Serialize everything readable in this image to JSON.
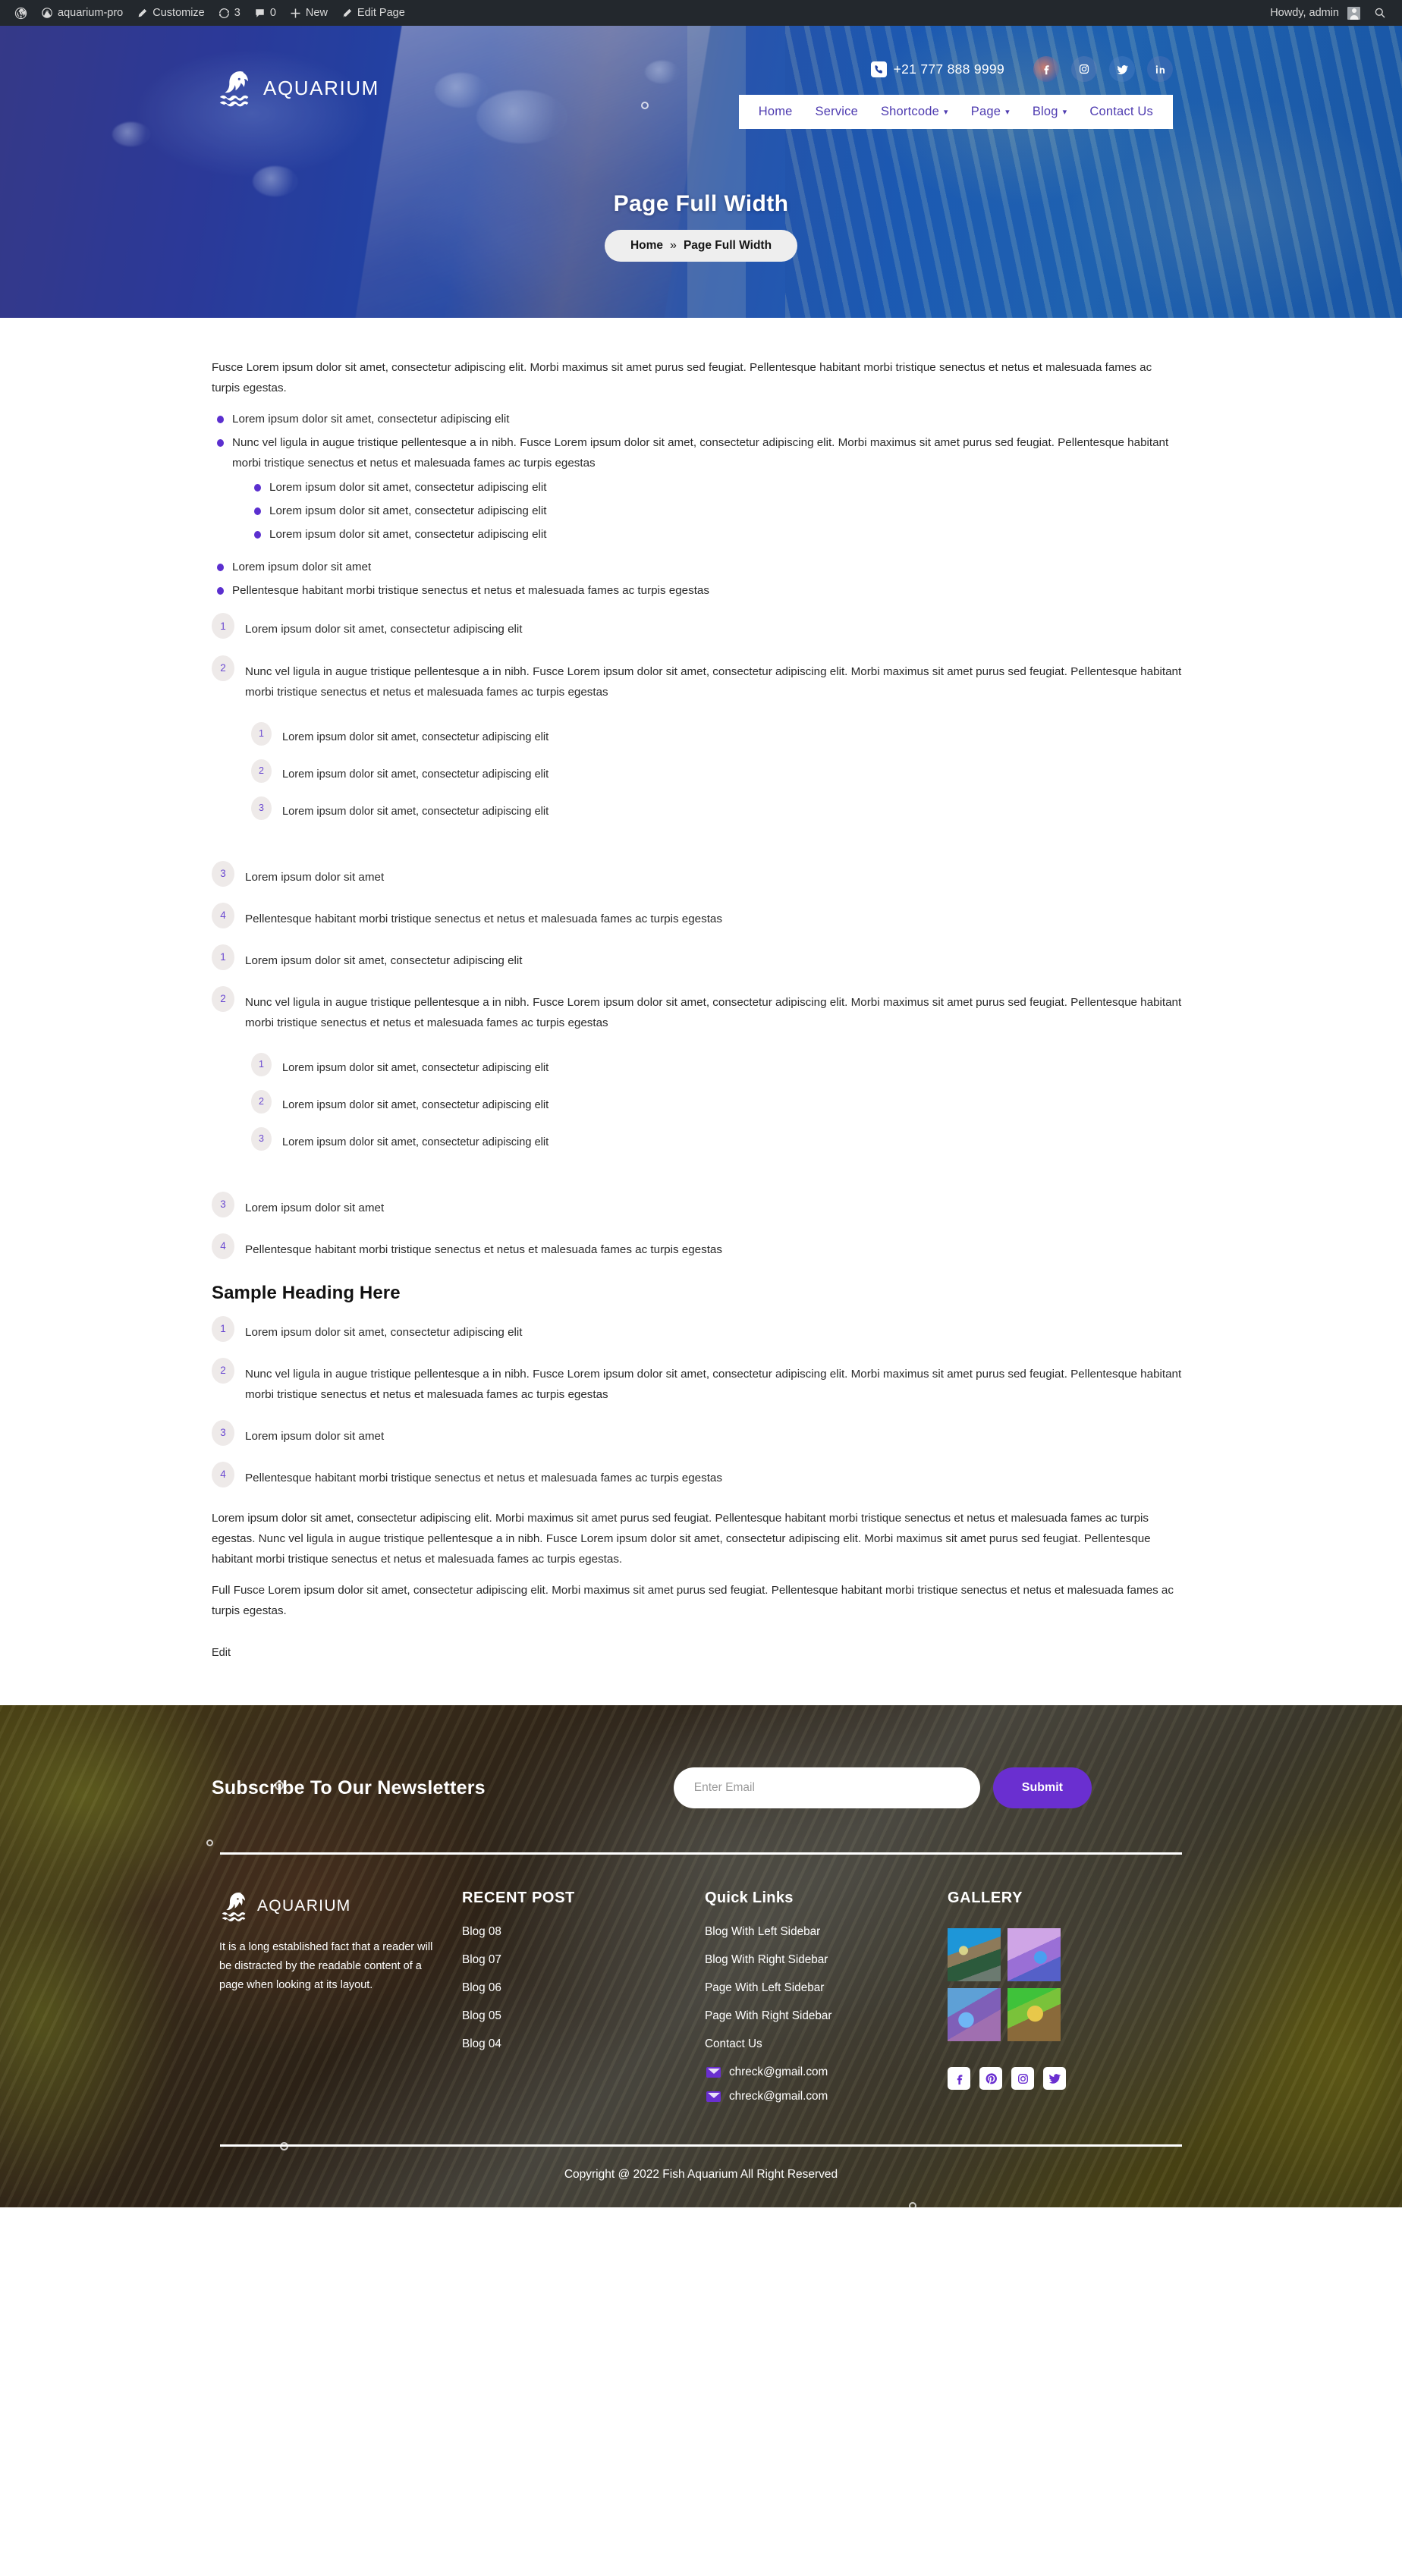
{
  "adminbar": {
    "wp_logo_icon": "wordpress-icon",
    "site_icon": "dashboard-icon",
    "site_name": "aquarium-pro",
    "customize_icon": "pencil-icon",
    "customize_label": "Customize",
    "updates_icon": "updates-icon",
    "updates_count": "3",
    "comments_icon": "comment-icon",
    "comments_count": "0",
    "new_icon": "plus-icon",
    "new_label": "New",
    "edit_icon": "edit-pencil-icon",
    "edit_label": "Edit Page",
    "howdy": "Howdy, admin",
    "avatar_icon": "user-avatar-icon",
    "search_icon": "search-icon"
  },
  "header": {
    "logo_icon": "dolphin-logo-icon",
    "logo_text": "AQUARIUM",
    "phone_icon": "phone-icon",
    "phone": "+21 777 888 9999",
    "socials": [
      {
        "name": "facebook-icon",
        "glyph": "f"
      },
      {
        "name": "instagram-icon",
        "glyph": "ig"
      },
      {
        "name": "twitter-icon",
        "glyph": "tw"
      },
      {
        "name": "linkedin-icon",
        "glyph": "in"
      }
    ],
    "nav": [
      {
        "label": "Home",
        "has_caret": false
      },
      {
        "label": "Service",
        "has_caret": false
      },
      {
        "label": "Shortcode",
        "has_caret": true
      },
      {
        "label": "Page",
        "has_caret": true
      },
      {
        "label": "Blog",
        "has_caret": true
      },
      {
        "label": "Contact Us",
        "has_caret": false
      }
    ]
  },
  "hero": {
    "title": "Page Full Width",
    "breadcrumb_home": "Home",
    "breadcrumb_sep": "»",
    "breadcrumb_current": "Page Full Width"
  },
  "main": {
    "intro_paragraph": "Fusce Lorem ipsum dolor sit amet, consectetur adipiscing elit. Morbi maximus sit amet purus sed feugiat. Pellentesque habitant morbi tristique senectus et netus et malesuada fames ac turpis egestas.",
    "bullets": {
      "item1": "Lorem ipsum dolor sit amet, consectetur adipiscing elit",
      "item2": "Nunc vel ligula in augue tristique pellentesque a in nibh. Fusce Lorem ipsum dolor sit amet, consectetur adipiscing elit. Morbi maximus sit amet purus sed feugiat. Pellentesque habitant morbi tristique senectus et netus et malesuada fames ac turpis egestas",
      "sub1": "Lorem ipsum dolor sit amet, consectetur adipiscing elit",
      "sub2": "Lorem ipsum dolor sit amet, consectetur adipiscing elit",
      "sub3": "Lorem ipsum dolor sit amet, consectetur adipiscing elit",
      "item3": "Lorem ipsum dolor sit amet",
      "item4": "Pellentesque habitant morbi tristique senectus et netus et malesuada fames ac turpis egestas"
    },
    "numlist_a": {
      "n1": "1",
      "t1": "Lorem ipsum dolor sit amet, consectetur adipiscing elit",
      "n2": "2",
      "t2": "Nunc vel ligula in augue tristique pellentesque a in nibh. Fusce Lorem ipsum dolor sit amet, consectetur adipiscing elit. Morbi maximus sit amet purus sed feugiat. Pellentesque habitant morbi tristique senectus et netus et malesuada fames ac turpis egestas",
      "s1n": "1",
      "s1t": "Lorem ipsum dolor sit amet, consectetur adipiscing elit",
      "s2n": "2",
      "s2t": "Lorem ipsum dolor sit amet, consectetur adipiscing elit",
      "s3n": "3",
      "s3t": "Lorem ipsum dolor sit amet, consectetur adipiscing elit",
      "n3": "3",
      "t3": "Lorem ipsum dolor sit amet",
      "n4": "4",
      "t4": "Pellentesque habitant morbi tristique senectus et netus et malesuada fames ac turpis egestas"
    },
    "numlist_b": {
      "n1": "1",
      "t1": "Lorem ipsum dolor sit amet, consectetur adipiscing elit",
      "n2": "2",
      "t2": "Nunc vel ligula in augue tristique pellentesque a in nibh. Fusce Lorem ipsum dolor sit amet, consectetur adipiscing elit. Morbi maximus sit amet purus sed feugiat. Pellentesque habitant morbi tristique senectus et netus et malesuada fames ac turpis egestas",
      "s1n": "1",
      "s1t": "Lorem ipsum dolor sit amet, consectetur adipiscing elit",
      "s2n": "2",
      "s2t": "Lorem ipsum dolor sit amet, consectetur adipiscing elit",
      "s3n": "3",
      "s3t": "Lorem ipsum dolor sit amet, consectetur adipiscing elit",
      "n3": "3",
      "t3": "Lorem ipsum dolor sit amet",
      "n4": "4",
      "t4": "Pellentesque habitant morbi tristique senectus et netus et malesuada fames ac turpis egestas"
    },
    "sample_heading": "Sample Heading Here",
    "numlist_c": {
      "n1": "1",
      "t1": "Lorem ipsum dolor sit amet, consectetur adipiscing elit",
      "n2": "2",
      "t2": "Nunc vel ligula in augue tristique pellentesque a in nibh. Fusce Lorem ipsum dolor sit amet, consectetur adipiscing elit. Morbi maximus sit amet purus sed feugiat. Pellentesque habitant morbi tristique senectus et netus et malesuada fames ac turpis egestas",
      "n3": "3",
      "t3": "Lorem ipsum dolor sit amet",
      "n4": "4",
      "t4": "Pellentesque habitant morbi tristique senectus et netus et malesuada fames ac turpis egestas"
    },
    "closing_paragraph_1": "Lorem ipsum dolor sit amet, consectetur adipiscing elit. Morbi maximus sit amet purus sed feugiat. Pellentesque habitant morbi tristique senectus et netus et malesuada fames ac turpis egestas. Nunc vel ligula in augue tristique pellentesque a in nibh. Fusce Lorem ipsum dolor sit amet, consectetur adipiscing elit. Morbi maximus sit amet purus sed feugiat. Pellentesque habitant morbi tristique senectus et netus et malesuada fames ac turpis egestas.",
    "closing_paragraph_2": "Full Fusce Lorem ipsum dolor sit amet, consectetur adipiscing elit. Morbi maximus sit amet purus sed feugiat. Pellentesque habitant morbi tristique senectus et netus et malesuada fames ac turpis egestas.",
    "edit_label": "Edit"
  },
  "subscribe": {
    "title": "Subscribe To Our Newsletters",
    "placeholder": "Enter Email",
    "value": "",
    "submit_label": "Submit"
  },
  "footer": {
    "logo_icon": "dolphin-logo-icon",
    "logo_text": "AQUARIUM",
    "description": "It is a long established fact that a reader will be distracted by the readable content of a page when looking at its layout.",
    "recent_heading": "RECENT POST",
    "recent_posts": [
      "Blog 08",
      "Blog 07",
      "Blog 06",
      "Blog 05",
      "Blog 04"
    ],
    "quick_heading": "Quick Links",
    "quick_links": [
      "Blog With Left Sidebar",
      "Blog With Right Sidebar",
      "Page With Left Sidebar",
      "Page With Right Sidebar",
      "Contact Us"
    ],
    "email_icon": "envelope-icon",
    "email1": "chreck@gmail.com",
    "email2": "chreck@gmail.com",
    "gallery_heading": "GALLERY",
    "gallery_items": [
      "gallery-thumb-angelfish",
      "gallery-thumb-purple-coral",
      "gallery-thumb-blue-school",
      "gallery-thumb-ram-cichlid"
    ],
    "socials": [
      {
        "name": "facebook-icon"
      },
      {
        "name": "pinterest-icon"
      },
      {
        "name": "instagram-icon"
      },
      {
        "name": "twitter-icon"
      }
    ],
    "copyright": "Copyright @ 2022 Fish Aquarium All Right Reserved"
  },
  "colors": {
    "accent_purple": "#6a2fd0",
    "nav_link": "#4e3bb0",
    "adminbar_bg": "#23282d",
    "hero_blue": "#1d4db4"
  }
}
